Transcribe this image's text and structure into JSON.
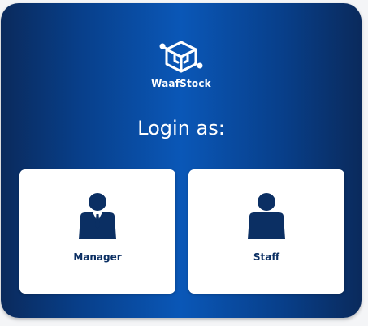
{
  "brand": {
    "name": "WaafStock",
    "logo_icon": "cube-circuit-logo"
  },
  "heading": "Login as:",
  "options": [
    {
      "label": "Manager",
      "icon": "manager-person-icon"
    },
    {
      "label": "Staff",
      "icon": "staff-person-icon"
    }
  ],
  "colors": {
    "background_dark": "#0a2a5c",
    "background_light": "#0a57b7",
    "icon_navy": "#0b2f63",
    "card_white": "#ffffff"
  }
}
